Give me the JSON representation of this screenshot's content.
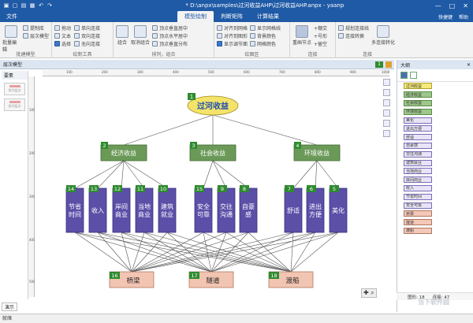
{
  "titlebar": {
    "title": "* D:\\anpx\\samples\\过河收益AHP\\过河收益AHP.anpx - yaanp",
    "min": "—",
    "max": "□",
    "close": "✕"
  },
  "menu": {
    "file": "文件",
    "tabs": [
      "模型绘制",
      "判断矩阵",
      "计算结果"
    ],
    "active_tab": "模型绘制",
    "shortcut": "快捷键",
    "help": "帮助"
  },
  "ribbon": {
    "g1": {
      "big": "批量编辑",
      "items": [
        "提制库",
        "层次模型"
      ],
      "label": "批建模型"
    },
    "g2": {
      "items": [
        "拖动",
        "文本",
        "选择",
        "单向连接",
        "双向连接",
        "无向连接"
      ],
      "label": "绘制工具"
    },
    "g3": {
      "items": [
        "组合",
        "取消组合",
        "顶点垂直居中",
        "顶点水平居中",
        "顶点垂直分布"
      ],
      "label": "排列，组合"
    },
    "g4": {
      "items": [
        "对齐到网格",
        "对齐到图形",
        "显示调节面",
        "显示网格线",
        "背景颜色",
        "网格颜色"
      ],
      "label": "绘图区"
    },
    "g5": {
      "big": "重画节点",
      "items": [
        "+棚交",
        "+号形",
        "+留空"
      ],
      "label": "连接"
    },
    "g6": {
      "items": [
        "规划连接线",
        "连接转换",
        "多连接转化"
      ],
      "label": "连接"
    }
  },
  "doc": {
    "tab": "层次模型",
    "badge": "1"
  },
  "left_panel": {
    "header": "要素",
    "thumbs": [
      "排列层次",
      "排列层次"
    ]
  },
  "ruler": {
    "top": [
      "100",
      "200",
      "300",
      "400",
      "500",
      "600",
      "700",
      "800",
      "900",
      "1000"
    ],
    "left": [
      "100",
      "200",
      "300",
      "400",
      "500"
    ]
  },
  "model": {
    "goal": {
      "id": "1",
      "label": "过河收益"
    },
    "criteria": [
      {
        "id": "2",
        "label": "经济收益"
      },
      {
        "id": "3",
        "label": "社会收益"
      },
      {
        "id": "4",
        "label": "环境收益"
      }
    ],
    "subs": [
      {
        "id": "14",
        "label": "节省时间"
      },
      {
        "id": "13",
        "label": "收入"
      },
      {
        "id": "12",
        "label": "岸间商业"
      },
      {
        "id": "11",
        "label": "当地商业"
      },
      {
        "id": "10",
        "label": "建筑就业"
      },
      {
        "id": "15",
        "label": "安全可靠"
      },
      {
        "id": "9",
        "label": "交往沟通"
      },
      {
        "id": "8",
        "label": "自豪感"
      },
      {
        "id": "7",
        "label": "舒适"
      },
      {
        "id": "6",
        "label": "进出方便"
      },
      {
        "id": "5",
        "label": "美化"
      }
    ],
    "alternatives": [
      {
        "id": "16",
        "label": "桥梁"
      },
      {
        "id": "17",
        "label": "隧道"
      },
      {
        "id": "18",
        "label": "渡船"
      }
    ]
  },
  "colors": {
    "goal": "#f3e36a",
    "criteria": "#6b9a58",
    "sub": "#5b4fa8",
    "alt": "#f2c4b2",
    "accent": "#1f5aa6"
  },
  "right_panel": {
    "header": "大纲",
    "items": [
      {
        "label": "过河收益",
        "kind": "goal"
      },
      {
        "label": "经济收益",
        "kind": "crit"
      },
      {
        "label": "社会收益",
        "kind": "crit"
      },
      {
        "label": "环境收益",
        "kind": "crit"
      },
      {
        "label": "美化",
        "kind": "sub"
      },
      {
        "label": "进出方便",
        "kind": "sub"
      },
      {
        "label": "舒适",
        "kind": "sub"
      },
      {
        "label": "自豪感",
        "kind": "sub"
      },
      {
        "label": "交往沟通",
        "kind": "sub"
      },
      {
        "label": "建筑就业",
        "kind": "sub"
      },
      {
        "label": "当地商业",
        "kind": "sub"
      },
      {
        "label": "岸间商业",
        "kind": "sub"
      },
      {
        "label": "收入",
        "kind": "sub"
      },
      {
        "label": "节省时间",
        "kind": "sub"
      },
      {
        "label": "安全可靠",
        "kind": "sub"
      },
      {
        "label": "桥梁",
        "kind": "alt"
      },
      {
        "label": "隧道",
        "kind": "alt"
      },
      {
        "label": "渡船",
        "kind": "alt"
      }
    ],
    "status_shapes": "图形: 18",
    "status_links": "连接: 47"
  },
  "bottom_tab": "演示",
  "statusbar": "就绪",
  "watermark": "当下软件园"
}
